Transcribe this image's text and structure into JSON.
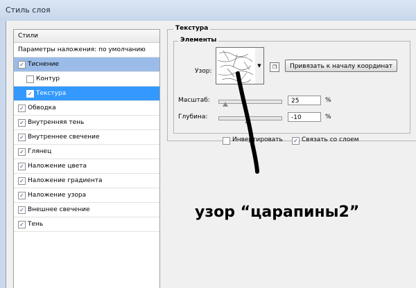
{
  "window": {
    "title": "Стиль слоя"
  },
  "styles_panel": {
    "header": "Стили",
    "blending_options": "Параметры наложения: по умолчанию",
    "items": [
      {
        "label": "Тиснение",
        "checked": "✓",
        "state": "highlight",
        "level": 0
      },
      {
        "label": "Контур",
        "checked": "",
        "state": "",
        "level": 1
      },
      {
        "label": "Текстура",
        "checked": "✓",
        "state": "selected",
        "level": 1
      },
      {
        "label": "Обводка",
        "checked": "✓",
        "state": "",
        "level": 0
      },
      {
        "label": "Внутренняя тень",
        "checked": "✓",
        "state": "",
        "level": 0
      },
      {
        "label": "Внутреннее свечение",
        "checked": "✓",
        "state": "",
        "level": 0
      },
      {
        "label": "Глянец",
        "checked": "✓",
        "state": "",
        "level": 0
      },
      {
        "label": "Наложение цвета",
        "checked": "✓",
        "state": "",
        "level": 0
      },
      {
        "label": "Наложение градиента",
        "checked": "✓",
        "state": "",
        "level": 0
      },
      {
        "label": "Наложение узора",
        "checked": "✓",
        "state": "",
        "level": 0
      },
      {
        "label": "Внешнее свечение",
        "checked": "✓",
        "state": "",
        "level": 0
      },
      {
        "label": "Тень",
        "checked": "✓",
        "state": "",
        "level": 0
      }
    ]
  },
  "texture": {
    "group_title": "Текстура",
    "elements_title": "Элементы",
    "pattern_label": "Узор:",
    "snap_button": "Привязать к началу координат",
    "scale_label": "Масштаб:",
    "scale_value": "25",
    "scale_slider_fraction": 0.1,
    "depth_label": "Глубина:",
    "depth_value": "-10",
    "depth_slider_fraction": 0.45,
    "unit": "%",
    "invert_label": "Инвертировать",
    "invert_checked": "",
    "link_label": "Связать со слоем",
    "link_checked": "✓"
  },
  "annotation": {
    "text": "узор “царапины2”"
  },
  "colors": {
    "selected": "#3399ff",
    "highlight": "#9bbce8"
  }
}
